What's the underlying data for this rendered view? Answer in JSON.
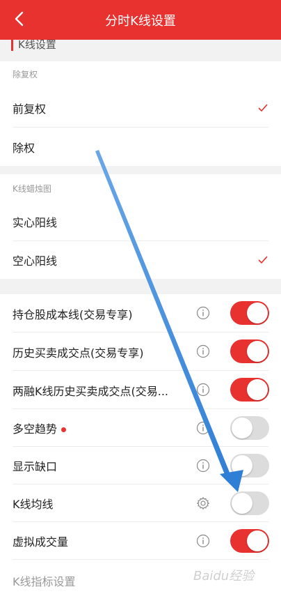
{
  "header": {
    "title": "分时K线设置",
    "back_icon": "chevron-left-icon"
  },
  "top_strip": {
    "label": "K线设置"
  },
  "section1": {
    "title": "除复权",
    "options": [
      {
        "label": "前复权",
        "checked": true
      },
      {
        "label": "除权",
        "checked": false
      }
    ]
  },
  "section2": {
    "title": "K线蜡烛图",
    "options": [
      {
        "label": "实心阳线",
        "checked": false
      },
      {
        "label": "空心阳线",
        "checked": true
      }
    ]
  },
  "toggles": [
    {
      "label": "持仓股成本线(交易专享)",
      "icon": "info-icon",
      "on": true
    },
    {
      "label": "历史买卖成交点(交易专享)",
      "icon": "info-icon",
      "on": true
    },
    {
      "label": "两融K线历史买卖成交点(交易...",
      "icon": "info-icon",
      "on": true
    },
    {
      "label": "多空趋势",
      "icon": "info-icon",
      "on": false,
      "badge": true
    },
    {
      "label": "显示缺口",
      "icon": "info-icon",
      "on": false
    },
    {
      "label": "K线均线",
      "icon": "gear-icon",
      "on": false
    },
    {
      "label": "虚拟成交量",
      "icon": "info-icon",
      "on": true
    }
  ],
  "footer": {
    "label": "K线指标设置"
  },
  "watermark": {
    "text": "Baidu经验"
  },
  "colors": {
    "accent": "#e8322f",
    "toggle_off": "#dcdcdc",
    "arrow": "#3a86d8"
  }
}
